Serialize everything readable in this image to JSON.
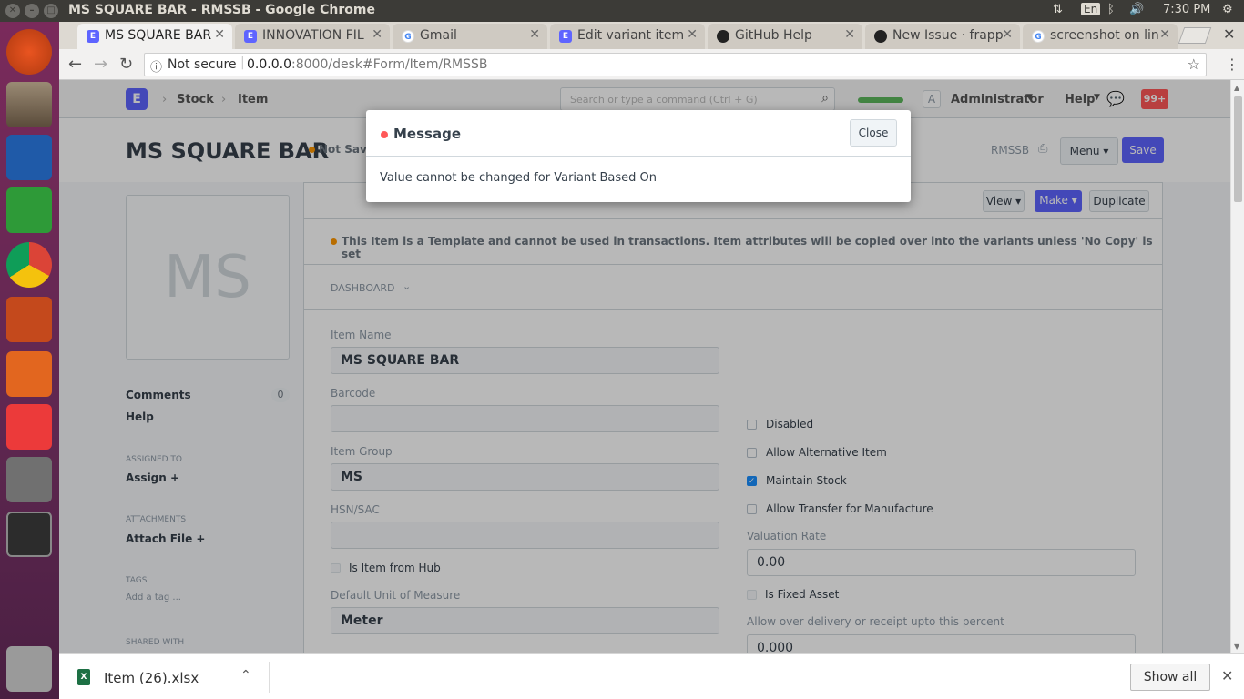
{
  "window": {
    "title": "MS SQUARE BAR - RMSSB - Google Chrome",
    "tray_lang": "En",
    "clock": "7:30 PM"
  },
  "tabs": [
    {
      "label": "MS SQUARE BAR",
      "fav": "E",
      "icon": "erpnext-icon"
    },
    {
      "label": "INNOVATION FIL",
      "fav": "E",
      "icon": "erpnext-icon"
    },
    {
      "label": "Gmail",
      "fav": "G",
      "icon": "google-icon"
    },
    {
      "label": "Edit variant item",
      "fav": "E",
      "icon": "erpnext-icon"
    },
    {
      "label": "GitHub Help",
      "fav": "",
      "icon": "github-icon"
    },
    {
      "label": "New Issue · frapp",
      "fav": "",
      "icon": "github-icon"
    },
    {
      "label": "screenshot on lin",
      "fav": "G",
      "icon": "google-icon"
    }
  ],
  "address": {
    "security": "Not secure",
    "host": "0.0.0.0",
    "path": ":8000/desk#Form/Item/RMSSB"
  },
  "navbar": {
    "logo": "E",
    "breadcrumbs": [
      "Stock",
      "Item"
    ],
    "search_placeholder": "Search or type a command (Ctrl + G)",
    "avatar": "A",
    "user": "Administrator",
    "help": "Help",
    "notifications": "99+"
  },
  "page": {
    "title": "MS SQUARE BAR",
    "status": "Not Saved",
    "docname": "RMSSB",
    "menu_label": "Menu",
    "save_label": "Save",
    "view_label": "View",
    "make_label": "Make",
    "duplicate_label": "Duplicate"
  },
  "sidebar": {
    "image_initials": "MS",
    "comments_label": "Comments",
    "comments_count": "0",
    "help_label": "Help",
    "assigned_heading": "ASSIGNED TO",
    "assign_label": "Assign +",
    "attachments_heading": "ATTACHMENTS",
    "attach_label": "Attach File +",
    "tags_heading": "TAGS",
    "add_tag": "Add a tag ...",
    "shared_heading": "SHARED WITH"
  },
  "form": {
    "template_alert": "This Item is a Template and cannot be used in transactions. Item attributes will be copied over into the variants unless 'No Copy' is set",
    "dashboard_label": "DASHBOARD",
    "item_name_label": "Item Name",
    "item_name_value": "MS SQUARE BAR",
    "barcode_label": "Barcode",
    "barcode_value": "",
    "item_group_label": "Item Group",
    "item_group_value": "MS",
    "hsn_label": "HSN/SAC",
    "hsn_value": "",
    "from_hub_label": "Is Item from Hub",
    "uom_label": "Default Unit of Measure",
    "uom_value": "Meter",
    "disabled_label": "Disabled",
    "alt_item_label": "Allow Alternative Item",
    "maintain_stock_label": "Maintain Stock",
    "transfer_label": "Allow Transfer for Manufacture",
    "valuation_label": "Valuation Rate",
    "valuation_value": "0.00",
    "fixed_asset_label": "Is Fixed Asset",
    "over_delivery_label": "Allow over delivery or receipt upto this percent",
    "over_delivery_value": "0.000"
  },
  "modal": {
    "title": "Message",
    "close_label": "Close",
    "body": "Value cannot be changed for Variant Based On"
  },
  "downloads": {
    "file": "Item (26).xlsx",
    "show_all": "Show all"
  },
  "colors": {
    "accent": "#5e64ff",
    "indicator_orange": "#ff9800",
    "indicator_red": "#ff5858",
    "check_blue": "#1a8fff"
  }
}
